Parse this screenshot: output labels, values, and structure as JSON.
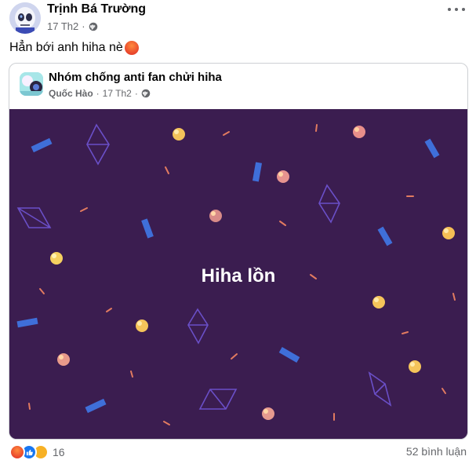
{
  "post": {
    "author": "Trịnh Bá Trường",
    "date": "17 Th2",
    "dot": "·",
    "privacy_icon": "globe-icon",
    "caption": "Hẳn bới anh hiha nè",
    "caption_emoji": "angry-face-icon"
  },
  "shared": {
    "group_name": "Nhóm chống anti fan chửi hiha",
    "author": "Quốc Hào",
    "date": "17 Th2",
    "dot": "·",
    "image_text": "Hiha lồn",
    "image_bg": "#3b1d50"
  },
  "footer": {
    "reaction_icons": [
      "angry-reaction-icon",
      "like-reaction-icon",
      "haha-reaction-icon"
    ],
    "reaction_count": "16",
    "comments": "52 bình luận"
  }
}
